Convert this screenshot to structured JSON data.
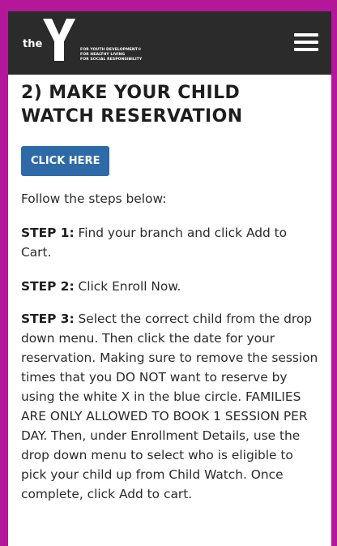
{
  "header": {
    "logo_word": "the",
    "tagline": [
      "FOR YOUTH DEVELOPMENT®",
      "FOR HEALTHY LIVING",
      "FOR SOCIAL RESPONSIBILITY"
    ],
    "menu_icon": "hamburger-menu-icon"
  },
  "main": {
    "title": "2) MAKE YOUR CHILD WATCH RESERVATION",
    "cta_label": "CLICK HERE",
    "intro": "Follow the steps below:",
    "steps": [
      {
        "label": "STEP 1:",
        "text": " Find your branch and click Add to Cart."
      },
      {
        "label": "STEP 2:",
        "text": " Click Enroll Now."
      },
      {
        "label": "STEP 3:",
        "text": " Select the correct child from the drop down menu. Then click the date for your reservation. Making sure to remove the session times that you DO NOT want to reserve by using the white X in the blue circle. FAMILIES ARE ONLY ALLOWED TO BOOK 1 SESSION PER DAY. Then, under Enrollment Details, use the drop down menu to select who is eligible to pick your child up from Child Watch. Once complete, click Add to cart."
      }
    ]
  },
  "colors": {
    "page_border": "#b4179a",
    "header_bg": "#2b2b2b",
    "button_bg": "#2f6aa8"
  }
}
